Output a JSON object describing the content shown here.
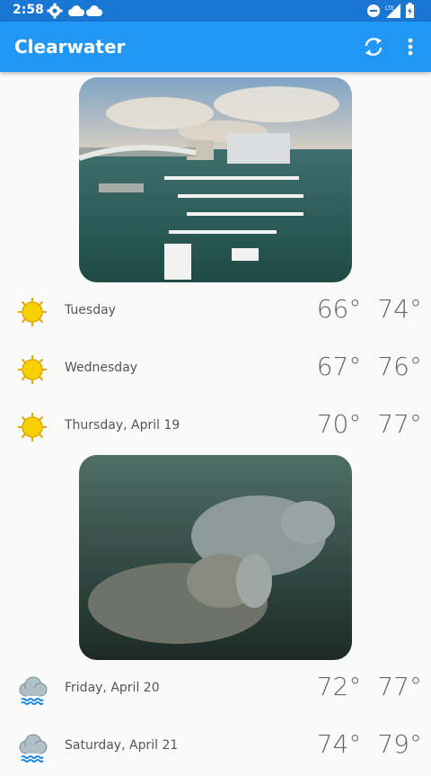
{
  "status": {
    "time": "2:58"
  },
  "app": {
    "title": "Clearwater"
  },
  "forecast": [
    {
      "day": "Tuesday",
      "low": "66°",
      "high": "74°",
      "condition": "sun-icon"
    },
    {
      "day": "Wednesday",
      "low": "67°",
      "high": "76°",
      "condition": "sun-icon"
    },
    {
      "day": "Thursday, April 19",
      "low": "70°",
      "high": "77°",
      "condition": "sun-icon"
    },
    {
      "day": "Friday, April 20",
      "low": "72°",
      "high": "77°",
      "condition": "rain-cloud-icon"
    },
    {
      "day": "Saturday, April 21",
      "low": "74°",
      "high": "79°",
      "condition": "rain-cloud-icon"
    }
  ],
  "colors": {
    "status_bar": "#1976d2",
    "app_bar": "#2196f3",
    "sun": "#f6d000",
    "cloud": "#b0bec5",
    "rain": "#1e88e5"
  }
}
